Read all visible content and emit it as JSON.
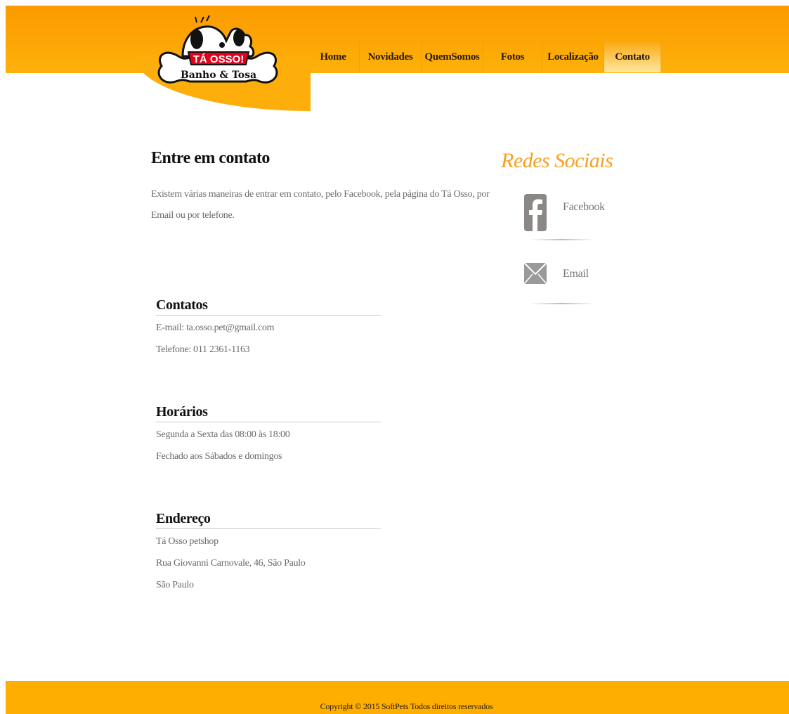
{
  "header": {
    "logo": {
      "brand": "TÁ OSSO!",
      "subtitle": "Banho & Tosa"
    },
    "nav": [
      {
        "label": "Home",
        "name": "nav-home",
        "width": 75
      },
      {
        "label": "Novidades",
        "name": "nav-novidades",
        "width": 88
      },
      {
        "label": "QuemSomos",
        "name": "nav-quemsomos",
        "width": 88
      },
      {
        "label": "Fotos",
        "name": "nav-fotos",
        "width": 84
      },
      {
        "label": "Localização",
        "name": "nav-localizacao",
        "width": 88
      },
      {
        "label": "Contato",
        "name": "nav-contato",
        "width": 81,
        "active": true
      }
    ]
  },
  "main": {
    "title": "Entre em contato",
    "intro": "Existem várias maneiras de entrar em contato, pelo Facebook, pela página do Tá Osso, por Email ou por telefone.",
    "sections": {
      "contatos": {
        "heading": "Contatos",
        "lines": [
          "E-mail: ta.osso.pet@gmail.com",
          "Telefone: 011 2361-1163"
        ]
      },
      "horarios": {
        "heading": "Horários",
        "lines": [
          "Segunda a Sexta das 08:00 às 18:00",
          "Fechado aos Sábados e domingos"
        ]
      },
      "endereco": {
        "heading": "Endereço",
        "lines": [
          "Tá Osso petshop",
          "Rua Giovanni Carnovale, 46, São Paulo",
          "São Paulo"
        ]
      }
    }
  },
  "sidebar": {
    "title": "Redes Sociais",
    "links": [
      {
        "label": "Facebook",
        "icon": "facebook-icon"
      },
      {
        "label": "Email",
        "icon": "envelope-icon"
      }
    ]
  },
  "footer": {
    "copyright": "Copyright © 2015 SoftPets Todos direitos reservados"
  },
  "colors": {
    "header_top": "#fb9a00",
    "header_bottom": "#fdb10a",
    "accent_title": "#f8a020",
    "footer": "#fdae00"
  }
}
